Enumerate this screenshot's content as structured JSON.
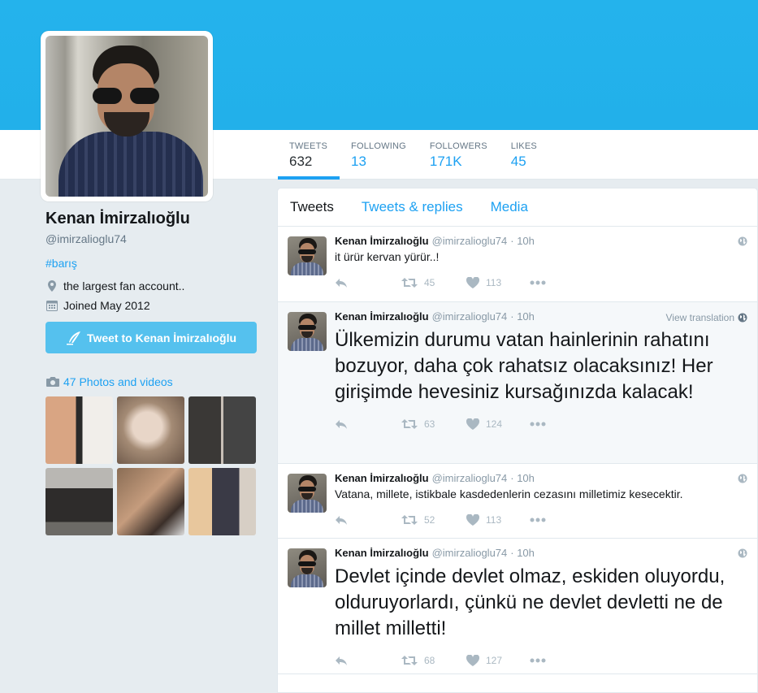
{
  "profile": {
    "name": "Kenan İmirzalıoğlu",
    "handle": "@imirzalioglu74",
    "hashtag": "#barış",
    "location": "the largest fan account..",
    "joined": "Joined May 2012",
    "tweet_button": "Tweet to Kenan İmirzalıoğlu",
    "photos_link": "47 Photos and videos"
  },
  "stats": [
    {
      "label": "TWEETS",
      "value": "632"
    },
    {
      "label": "FOLLOWING",
      "value": "13"
    },
    {
      "label": "FOLLOWERS",
      "value": "171K"
    },
    {
      "label": "LIKES",
      "value": "45"
    }
  ],
  "tabs": [
    "Tweets",
    "Tweets & replies",
    "Media"
  ],
  "tweets": [
    {
      "name": "Kenan İmirzalıoğlu",
      "handle": "@imirzalioglu74",
      "time": "· 10h",
      "text": "it ürür kervan yürür..!",
      "retweets": "45",
      "likes": "113"
    },
    {
      "name": "Kenan İmirzalıoğlu",
      "handle": "@imirzalioglu74",
      "time": "· 10h",
      "right": "View translation",
      "text": "Ülkemizin durumu vatan hainlerinin rahatını bozuyor, daha çok rahatsız olacaksınız! Her girişimde hevesiniz kursağınızda kalacak!",
      "retweets": "63",
      "likes": "124"
    },
    {
      "name": "Kenan İmirzalıoğlu",
      "handle": "@imirzalioglu74",
      "time": "· 10h",
      "text": "Vatana, millete, istikbale kasdedenlerin cezasını milletimiz kesecektir.",
      "retweets": "52",
      "likes": "113"
    },
    {
      "name": "Kenan İmirzalıoğlu",
      "handle": "@imirzalioglu74",
      "time": "· 10h",
      "text": "Devlet içinde devlet olmaz, eskiden oluyordu, olduruyorlardı, çünkü ne devlet devletti ne de millet milletti!",
      "retweets": "68",
      "likes": "127"
    }
  ],
  "colors": {
    "banner": "#22b0ea",
    "accent": "#1da1f2",
    "button": "#55c1ee"
  },
  "icons": [
    "location-icon",
    "calendar-icon",
    "quill-icon",
    "camera-icon",
    "globe-icon",
    "reply-icon",
    "retweet-icon",
    "heart-icon",
    "more-icon"
  ]
}
